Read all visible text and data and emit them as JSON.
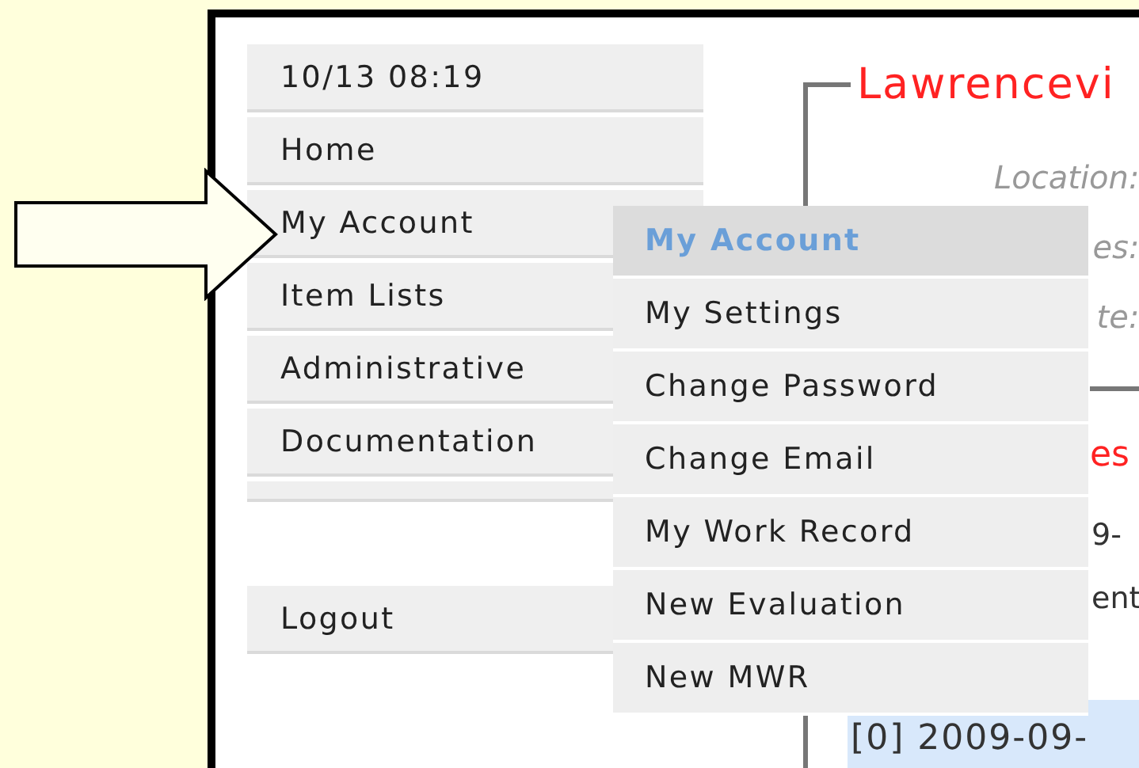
{
  "clock": "10/13 08:19",
  "nav": [
    "Home",
    "My Account",
    "Item Lists",
    "Administrative",
    "Documentation"
  ],
  "logout": "Logout",
  "submenu": [
    {
      "kind": "header",
      "label": "My Account"
    },
    {
      "kind": "item",
      "label": "My Settings"
    },
    {
      "kind": "item",
      "label": "Change Password"
    },
    {
      "kind": "item",
      "label": "Change Email"
    },
    {
      "kind": "item",
      "label": "My Work Record"
    },
    {
      "kind": "item",
      "label": "New Evaluation"
    },
    {
      "kind": "item",
      "label": "New MWR"
    }
  ],
  "content": {
    "legend": "Lawrencevi",
    "fields": [
      "Location:",
      "es:",
      "te:"
    ],
    "section_legend": "es",
    "lines": [
      "9-",
      "ent"
    ],
    "selected_row": "[0] 2009-09-"
  }
}
